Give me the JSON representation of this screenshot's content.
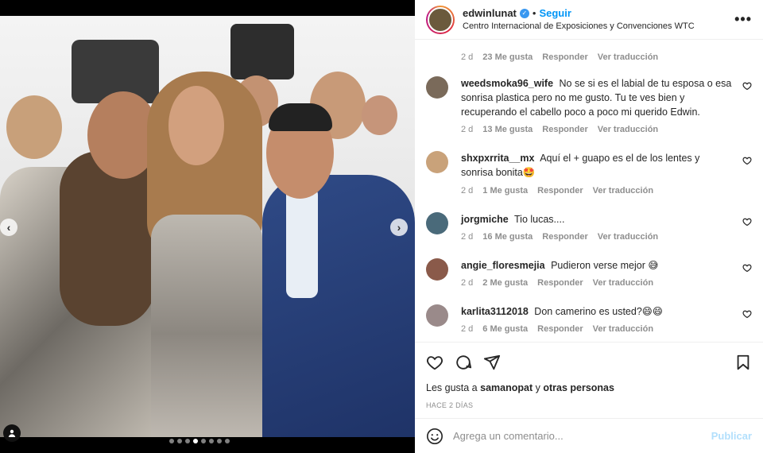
{
  "header": {
    "username": "edwinlunat",
    "follow_label": "Seguir",
    "separator": "•",
    "location": "Centro Internacional de Exposiciones y Convenciones WTC",
    "more": "•••"
  },
  "first_comment_meta": {
    "time": "2 d",
    "likes": "23 Me gusta",
    "reply": "Responder",
    "translate": "Ver traducción"
  },
  "comments": [
    {
      "user": "weedsmoka96_wife",
      "text": "No se si es el labial de tu esposa o esa sonrisa plastica pero no me gusto. Tu te ves bien y recuperando el cabello poco a poco mi querido Edwin.",
      "time": "2 d",
      "likes": "13 Me gusta",
      "reply": "Responder",
      "translate": "Ver traducción",
      "avatar_color": "#7a6a5a"
    },
    {
      "user": "shxpxrrita__mx",
      "text": "Aquí el + guapo es el de los lentes y sonrisa bonita🤩",
      "time": "2 d",
      "likes": "1 Me gusta",
      "reply": "Responder",
      "translate": "Ver traducción",
      "avatar_color": "#c9a27a"
    },
    {
      "user": "jorgmiche",
      "text": "Tio lucas....",
      "time": "2 d",
      "likes": "16 Me gusta",
      "reply": "Responder",
      "translate": "Ver traducción",
      "avatar_color": "#4a6a7a"
    },
    {
      "user": "angie_floresmejia",
      "text": "Pudieron verse mejor 😅",
      "time": "2 d",
      "likes": "2 Me gusta",
      "reply": "Responder",
      "translate": "Ver traducción",
      "avatar_color": "#8a5a4a"
    },
    {
      "user": "karlita3112018",
      "text": "Don camerino es usted?😄😄",
      "time": "2 d",
      "likes": "6 Me gusta",
      "reply": "Responder",
      "translate": "Ver traducción",
      "avatar_color": "#9a8a8a"
    }
  ],
  "likes_line": {
    "prefix": "Les gusta a",
    "user": "samanopat",
    "connector": "y",
    "others": "otras personas"
  },
  "timestamp": "HACE 2 DÍAS",
  "add_comment": {
    "placeholder": "Agrega un comentario...",
    "post_label": "Publicar"
  },
  "carousel": {
    "total": 8,
    "active_index": 3
  },
  "colors": {
    "link": "#0095f6",
    "muted": "#8e8e8e",
    "post_disabled": "#b2dffc"
  }
}
